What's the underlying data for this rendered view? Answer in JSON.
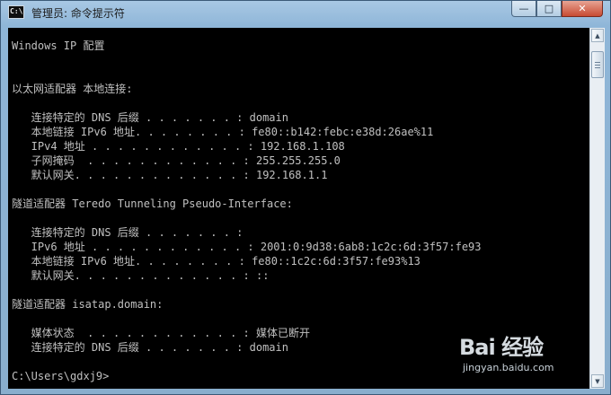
{
  "window": {
    "title": "管理员: 命令提示符",
    "icon_label": "C:\\",
    "buttons": {
      "minimize": "—",
      "maximize": "□",
      "close": "✕"
    }
  },
  "console": {
    "lines": [
      "Windows IP 配置",
      "",
      "",
      "以太网适配器 本地连接:",
      "",
      "   连接特定的 DNS 后缀 . . . . . . . : domain",
      "   本地链接 IPv6 地址. . . . . . . . : fe80::b142:febc:e38d:26ae%11",
      "   IPv4 地址 . . . . . . . . . . . . : 192.168.1.108",
      "   子网掩码  . . . . . . . . . . . . : 255.255.255.0",
      "   默认网关. . . . . . . . . . . . . : 192.168.1.1",
      "",
      "隧道适配器 Teredo Tunneling Pseudo-Interface:",
      "",
      "   连接特定的 DNS 后缀 . . . . . . . :",
      "   IPv6 地址 . . . . . . . . . . . . : 2001:0:9d38:6ab8:1c2c:6d:3f57:fe93",
      "   本地链接 IPv6 地址. . . . . . . . : fe80::1c2c:6d:3f57:fe93%13",
      "   默认网关. . . . . . . . . . . . . : ::",
      "",
      "隧道适配器 isatap.domain:",
      "",
      "   媒体状态  . . . . . . . . . . . . : 媒体已断开",
      "   连接特定的 DNS 后缀 . . . . . . . : domain",
      "",
      "C:\\Users\\gdxj9>"
    ]
  },
  "watermark": {
    "brand": "Bai 经验",
    "url": "jingyan.baidu.com"
  },
  "colors": {
    "console_bg": "#000000",
    "console_fg": "#c0c0c0"
  }
}
